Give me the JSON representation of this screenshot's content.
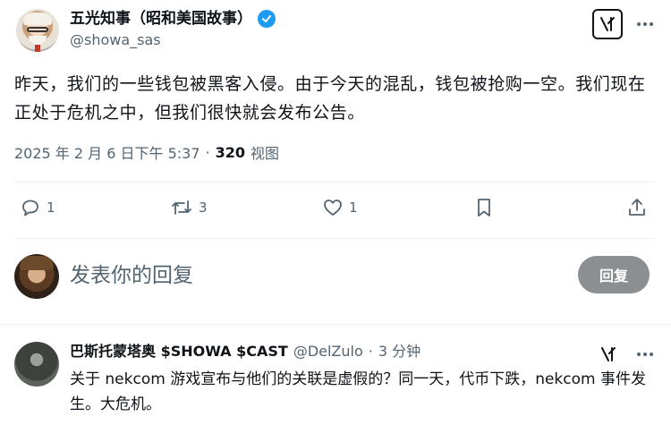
{
  "tweet": {
    "author_name": "五光知事（昭和美国故事）",
    "handle": "@showa_sas",
    "text": "昨天，我们的一些钱包被黑客入侵。由于今天的混乱，钱包被抢购一空。我们现在正处于危机之中，但我们很快就会发布公告。",
    "timestamp": "2025 年 2 月 6 日下午 5:37",
    "dot": "·",
    "views_count": "320",
    "views_label": "视图",
    "verified": true
  },
  "actions": {
    "reply_count": "1",
    "retweet_count": "3",
    "like_count": "1"
  },
  "reply_composer": {
    "placeholder": "发表你的回复",
    "button_label": "回复"
  },
  "reply": {
    "author_name": "巴斯托蒙塔奥 $SHOWA $CAST",
    "handle": "@DelZulo",
    "dot": "·",
    "time": "3 分钟",
    "text": "关于 nekcom 游戏宣布与他们的关联是虚假的？同一天，代币下跌，nekcom 事件发生。大危机。"
  },
  "colors": {
    "primary_text": "#0f1419",
    "secondary_text": "#536471",
    "verified_blue": "#1d9bf0",
    "divider": "#eff3f4",
    "reply_button_bg": "#8b8f92"
  },
  "icons": [
    "verified-badge-icon",
    "grok-icon",
    "more-icon",
    "reply-icon",
    "retweet-icon",
    "like-icon",
    "bookmark-icon",
    "share-icon"
  ]
}
